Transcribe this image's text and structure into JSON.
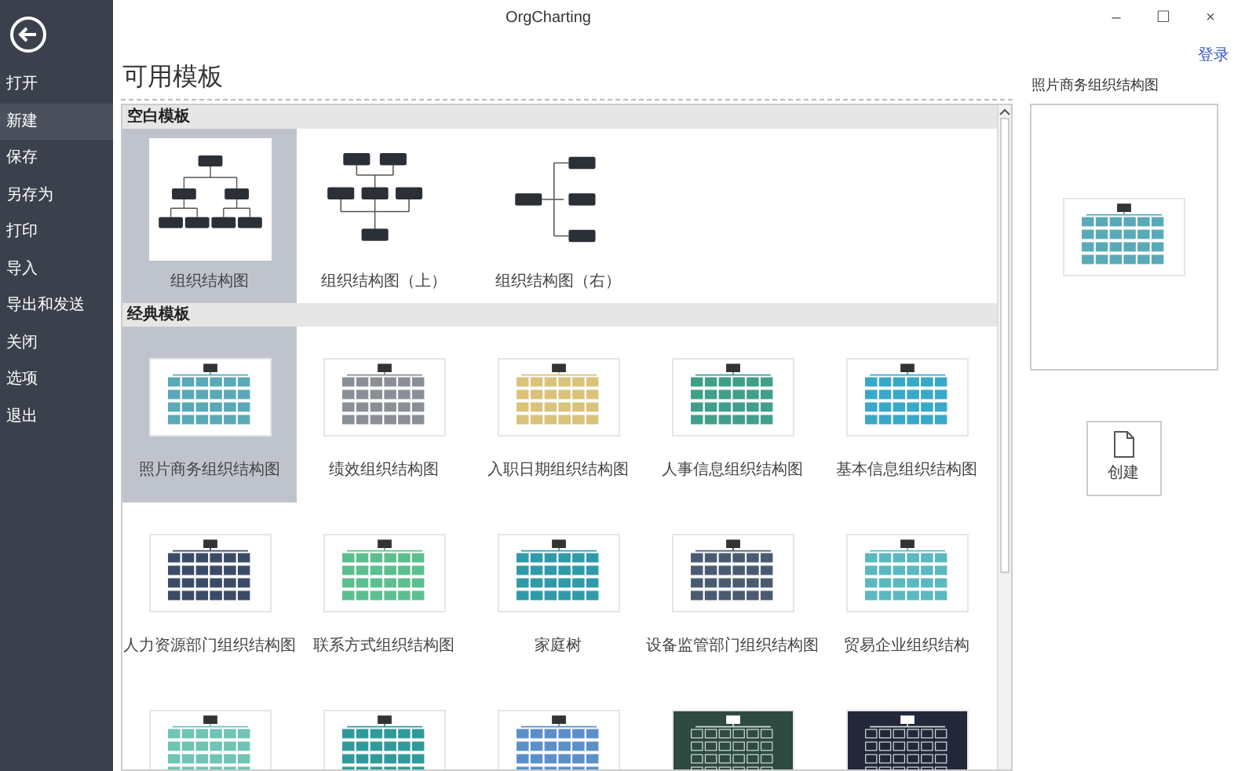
{
  "window": {
    "title": "OrgCharting",
    "controls": [
      "–",
      "☐",
      "×"
    ]
  },
  "login": "登录",
  "sidebar": {
    "items": [
      {
        "label": "打开",
        "selected": false
      },
      {
        "label": "新建",
        "selected": true
      },
      {
        "label": "保存",
        "selected": false
      },
      {
        "label": "另存为",
        "selected": false
      },
      {
        "label": "打印",
        "selected": false
      },
      {
        "label": "导入",
        "selected": false
      },
      {
        "label": "导出和发送",
        "selected": false
      },
      {
        "label": "关闭",
        "selected": false
      },
      {
        "label": "选项",
        "selected": false
      },
      {
        "label": "退出",
        "selected": false
      }
    ]
  },
  "heading": "可用模板",
  "sections": [
    {
      "title": "空白模板",
      "items": [
        {
          "label": "组织结构图",
          "kind": "down",
          "selected": true
        },
        {
          "label": "组织结构图（上）",
          "kind": "up",
          "selected": false
        },
        {
          "label": "组织结构图（右）",
          "kind": "right",
          "selected": false
        }
      ]
    },
    {
      "title": "经典模板",
      "items": [
        {
          "label": "照片商务组织结构图",
          "kind": "mini",
          "color": "#5aa9b8",
          "selected": true
        },
        {
          "label": "绩效组织结构图",
          "kind": "mini",
          "color": "#8a8f96",
          "selected": false
        },
        {
          "label": "入职日期组织结构图",
          "kind": "mini",
          "color": "#d9c27a",
          "selected": false
        },
        {
          "label": "人事信息组织结构图",
          "kind": "mini",
          "color": "#3f9f8a",
          "selected": false
        },
        {
          "label": "基本信息组织结构图",
          "kind": "mini",
          "color": "#38a8c8",
          "selected": false
        },
        {
          "label": "人力资源部门组织结构图",
          "kind": "mini",
          "color": "#3b4a66",
          "selected": false
        },
        {
          "label": "联系方式组织结构图",
          "kind": "mini",
          "color": "#5cbf8f",
          "selected": false
        },
        {
          "label": "家庭树",
          "kind": "mini",
          "color": "#2f9aa8",
          "selected": false
        },
        {
          "label": "设备监管部门组织结构图",
          "kind": "mini",
          "color": "#4a5a70",
          "selected": false
        },
        {
          "label": "贸易企业组织结构",
          "kind": "mini",
          "color": "#5ab8c0",
          "selected": false
        },
        {
          "kind": "mini",
          "color": "#6fc4b4",
          "selected": false
        },
        {
          "kind": "mini",
          "color": "#2f9a9a",
          "selected": false
        },
        {
          "kind": "mini",
          "color": "#5b8fc8",
          "selected": false
        },
        {
          "kind": "dark",
          "color": "#2f4a40",
          "selected": false
        },
        {
          "kind": "dark",
          "color": "#22283a",
          "selected": false
        }
      ]
    }
  ],
  "preview": {
    "title": "照片商务组织结构图",
    "color": "#5aa9b8"
  },
  "create_button": "创建"
}
